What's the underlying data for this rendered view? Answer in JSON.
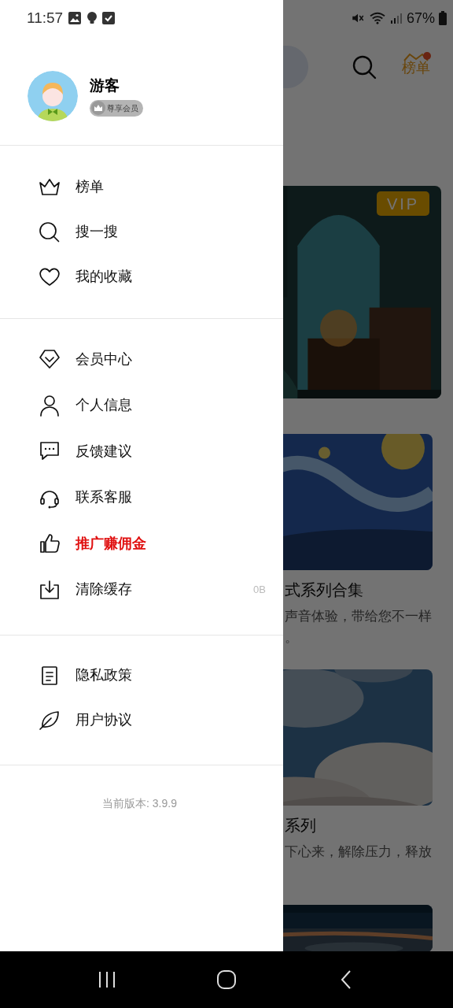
{
  "status_bar": {
    "time": "11:57",
    "battery": "67%"
  },
  "drawer": {
    "user": {
      "name": "游客",
      "badge": "尊享会员"
    },
    "sections": [
      [
        {
          "label": "榜单",
          "highlighted": false
        },
        {
          "label": "搜一搜",
          "highlighted": false
        },
        {
          "label": "我的收藏",
          "highlighted": false
        }
      ],
      [
        {
          "label": "会员中心",
          "highlighted": false
        },
        {
          "label": "个人信息",
          "highlighted": false
        },
        {
          "label": "反馈建议",
          "highlighted": false
        },
        {
          "label": "联系客服",
          "highlighted": false
        },
        {
          "label": "推广赚佣金",
          "highlighted": true
        },
        {
          "label": "清除缓存",
          "highlighted": false,
          "value": "0B"
        }
      ],
      [
        {
          "label": "隐私政策",
          "highlighted": false
        },
        {
          "label": "用户协议",
          "highlighted": false
        }
      ]
    ],
    "version": "当前版本: 3.9.9"
  },
  "header": {
    "ranking_label": "榜单",
    "ranking_dot": true
  },
  "cards": [
    {
      "kind": "picture",
      "badge": "VIP"
    },
    {
      "kind": "picture",
      "title": "式系列合集",
      "description": [
        "声音体验，带给您不一样",
        "。"
      ]
    },
    {
      "kind": "picture",
      "title": "系列",
      "description": [
        "下心来，解除压力，释放"
      ]
    },
    {
      "kind": "picture"
    }
  ]
}
